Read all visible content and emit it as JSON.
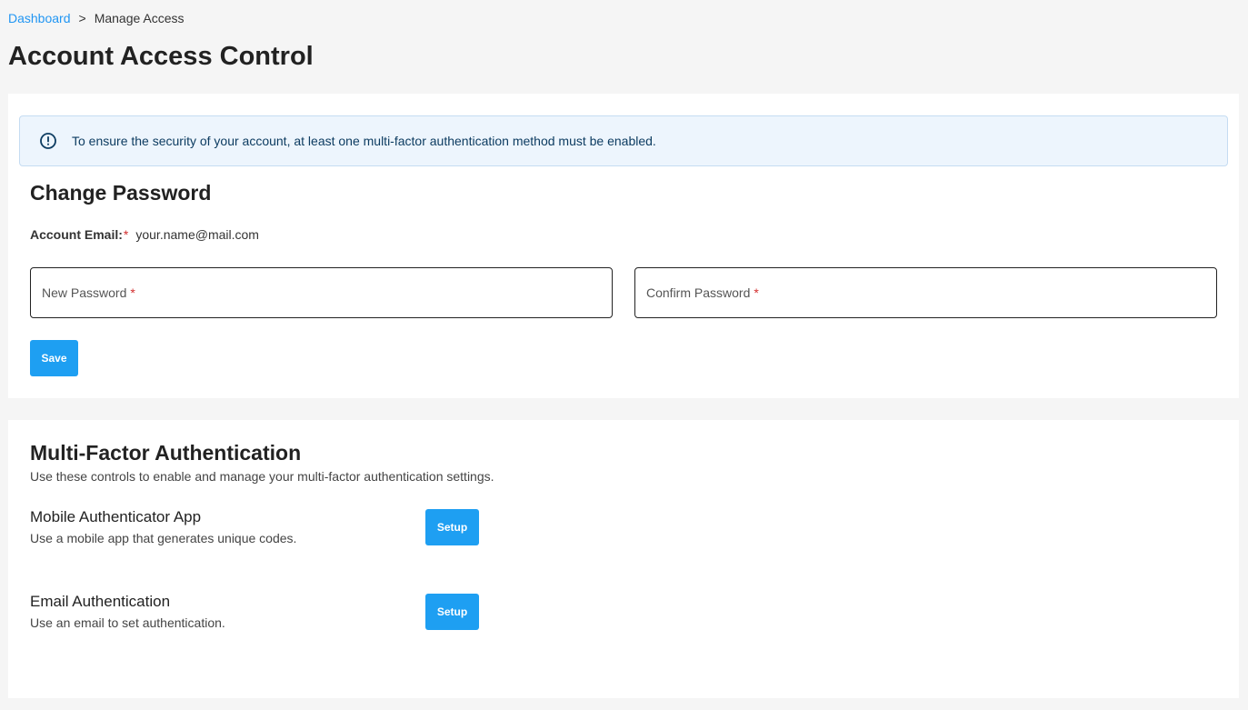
{
  "breadcrumb": {
    "home": "Dashboard",
    "separator": ">",
    "current": "Manage Access"
  },
  "page": {
    "title": "Account Access Control"
  },
  "alert": {
    "icon": "info-circle-icon",
    "message": "To ensure the security of your account, at least one multi-factor authentication method must be enabled."
  },
  "password_section": {
    "title": "Change Password",
    "email_label": "Account Email:",
    "required_mark": "*",
    "email_value": "your.name@mail.com",
    "new_password_placeholder": "New Password",
    "confirm_password_placeholder": "Confirm Password",
    "save_label": "Save"
  },
  "mfa_section": {
    "title": "Multi-Factor Authentication",
    "description": "Use these controls to enable and manage your multi-factor authentication settings.",
    "methods": [
      {
        "title": "Mobile Authenticator App",
        "description": "Use a mobile app that generates unique codes.",
        "button_label": "Setup"
      },
      {
        "title": "Email Authentication",
        "description": "Use an email to set authentication.",
        "button_label": "Setup"
      }
    ]
  },
  "colors": {
    "primary": "#1e9ff2",
    "link": "#2196f3",
    "alert_bg": "#edf5fd",
    "alert_text": "#0d3c61",
    "required": "#d32f2f",
    "page_bg": "#f5f5f5"
  }
}
